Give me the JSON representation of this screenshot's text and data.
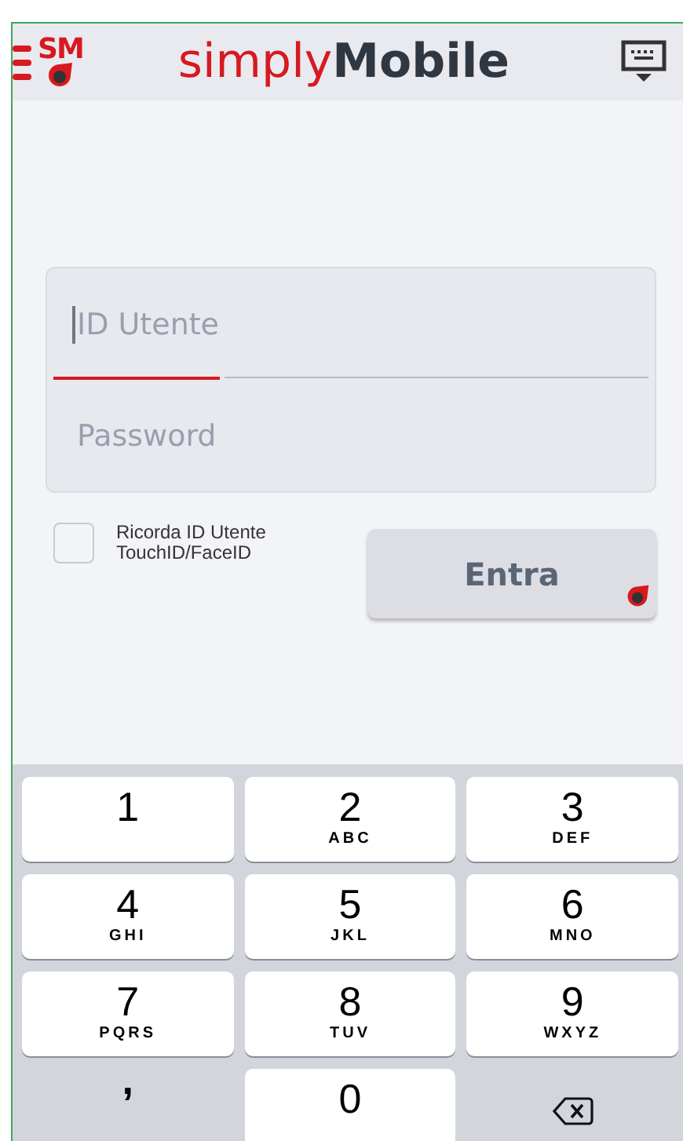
{
  "header": {
    "logo": "SM",
    "brand": [
      "simply",
      "Mobile"
    ]
  },
  "login": {
    "fields": [
      {
        "placeholder": "ID Utente",
        "focused": true
      },
      {
        "placeholder": "Password",
        "focused": false
      }
    ],
    "remember": {
      "label": "Ricorda ID Utente\nTouchID/FaceID",
      "checked": false
    },
    "submit": "Entra"
  },
  "keypad": [
    {
      "kind": "key",
      "digit": "1"
    },
    {
      "kind": "key",
      "digit": "2",
      "letters": "ABC"
    },
    {
      "kind": "key",
      "digit": "3",
      "letters": "DEF"
    },
    {
      "kind": "key",
      "digit": "4",
      "letters": "GHI"
    },
    {
      "kind": "key",
      "digit": "5",
      "letters": "JKL"
    },
    {
      "kind": "key",
      "digit": "6",
      "letters": "MNO"
    },
    {
      "kind": "key",
      "digit": "7",
      "letters": "PQRS"
    },
    {
      "kind": "key",
      "digit": "8",
      "letters": "TUV"
    },
    {
      "kind": "key",
      "digit": "9",
      "letters": "WXYZ"
    },
    {
      "kind": "plain",
      "digit": ","
    },
    {
      "kind": "key",
      "digit": "0"
    },
    {
      "kind": "backspace"
    }
  ]
}
